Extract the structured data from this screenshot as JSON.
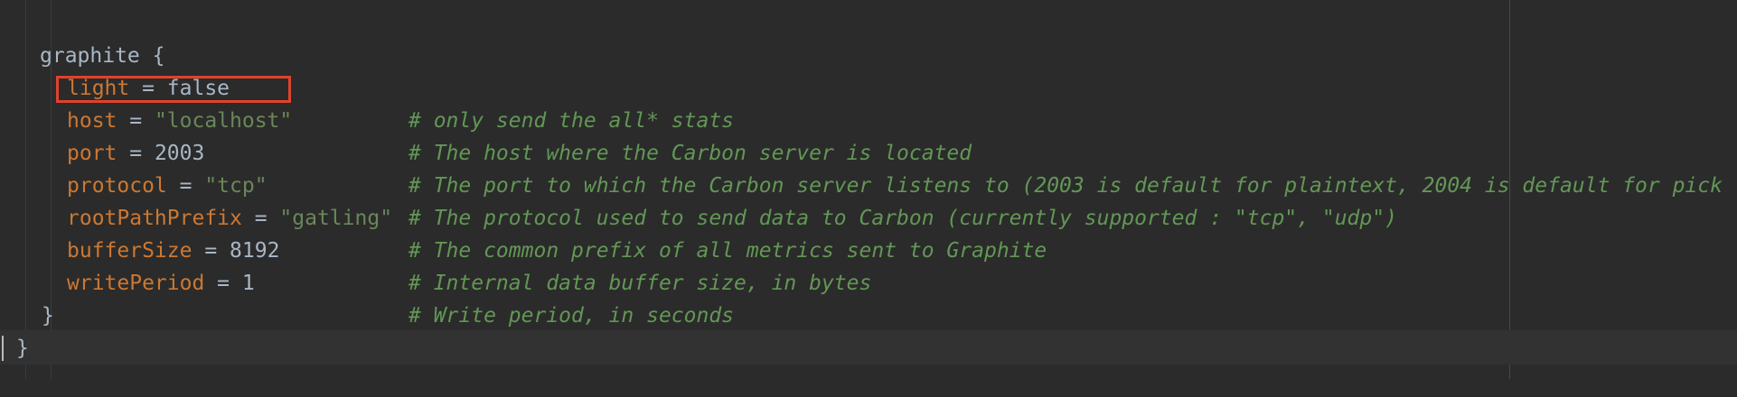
{
  "editor": {
    "lines": [
      {
        "kind": "open",
        "text": "graphite {"
      },
      {
        "kind": "prop",
        "key": "light",
        "op": " = ",
        "value": "false",
        "value_type": "plain",
        "comment": "# only send the all* stats"
      },
      {
        "kind": "prop",
        "key": "host",
        "op": " = ",
        "value": "\"localhost\"",
        "value_type": "str",
        "comment": "# The host where the Carbon server is located"
      },
      {
        "kind": "prop",
        "key": "port",
        "op": " = ",
        "value": "2003",
        "value_type": "plain",
        "comment": "# The port to which the Carbon server listens to (2003 is default for plaintext, 2004 is default for pick"
      },
      {
        "kind": "prop",
        "key": "protocol",
        "op": " = ",
        "value": "\"tcp\"",
        "value_type": "str",
        "comment": "# The protocol used to send data to Carbon (currently supported : \"tcp\", \"udp\")"
      },
      {
        "kind": "prop",
        "key": "rootPathPrefix",
        "op": " = ",
        "value": "\"gatling\"",
        "value_type": "str",
        "comment": "# The common prefix of all metrics sent to Graphite"
      },
      {
        "kind": "prop",
        "key": "bufferSize",
        "op": " = ",
        "value": "8192",
        "value_type": "plain",
        "comment": "# Internal data buffer size, in bytes"
      },
      {
        "kind": "prop",
        "key": "writePeriod",
        "op": " = ",
        "value": "1",
        "value_type": "plain",
        "comment": "# Write period, in seconds"
      },
      {
        "kind": "close",
        "text": "}"
      },
      {
        "kind": "close",
        "text": "}"
      }
    ],
    "highlighted_line": "host = \"localhost\""
  },
  "colors": {
    "background": "#2b2b2b",
    "keyword": "#cc7832",
    "string": "#6a8759",
    "comment": "#629755",
    "text": "#a9b7c6",
    "highlight_box": "#e0432b"
  }
}
